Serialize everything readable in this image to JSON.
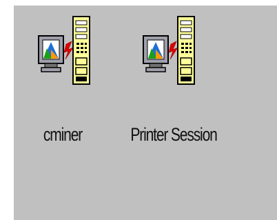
{
  "sessions": [
    {
      "label": "cminer",
      "icon": "pc-session-icon"
    },
    {
      "label": "Printer Session",
      "icon": "printer-session-icon"
    }
  ],
  "colors": {
    "background": "#c0c0c0",
    "tower": "#ffff99",
    "bolt": "#e00000",
    "monitor": "#9a9aa6"
  }
}
